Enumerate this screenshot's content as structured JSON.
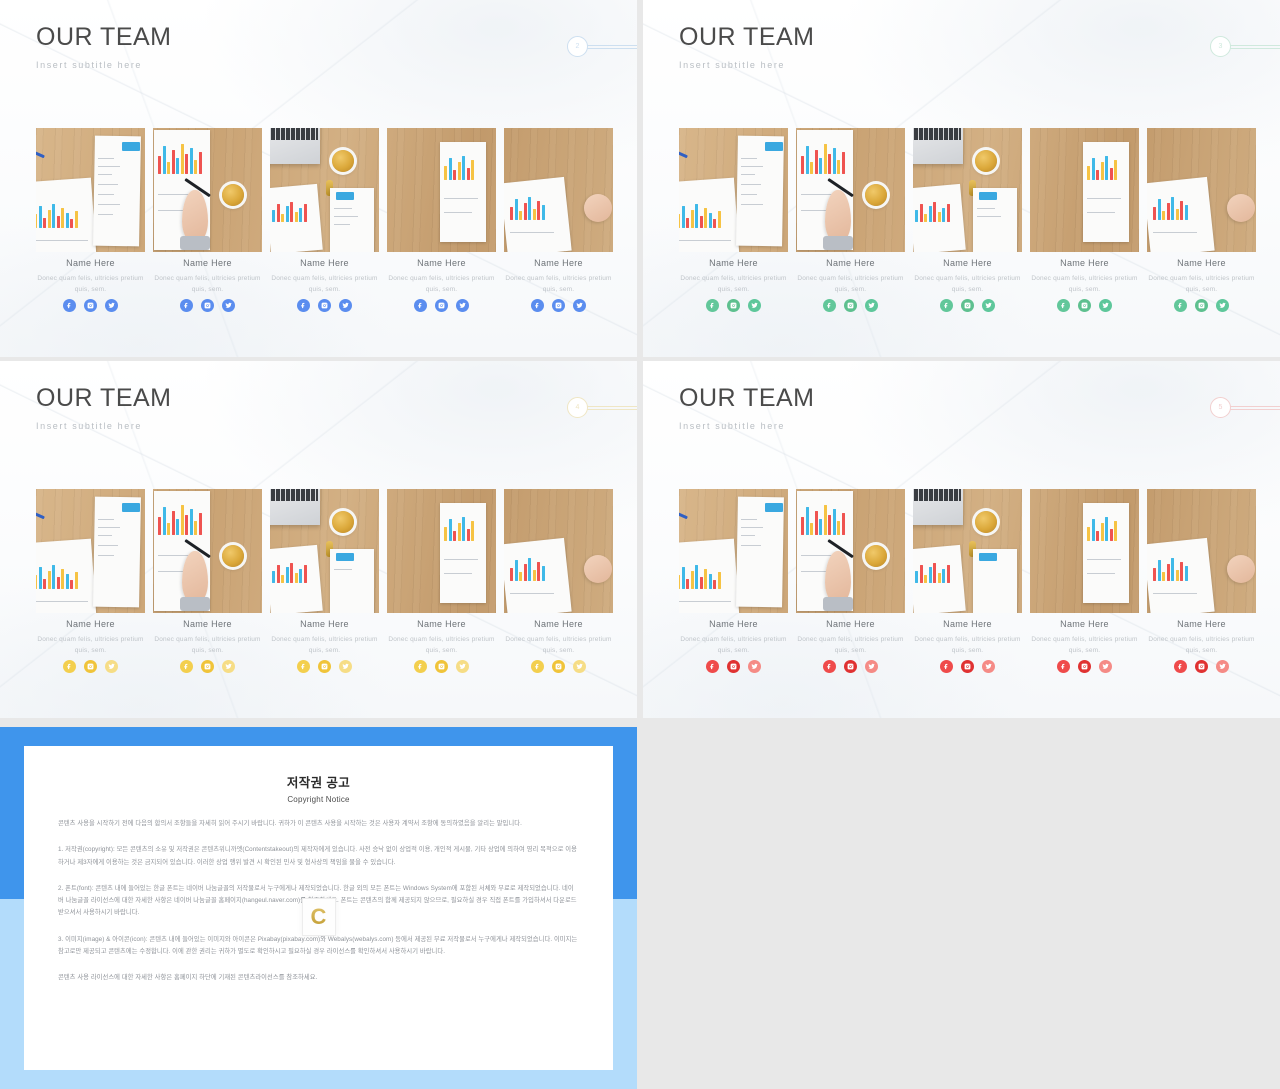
{
  "slides": [
    {
      "id": "slide-2",
      "theme": "blue",
      "title": "OUR TEAM",
      "subtitle": "Insert  subtitle  here",
      "badge": "2",
      "members": [
        {
          "name": "Name Here",
          "desc": "Donec  quam  felis,  ultricies  pretium  quis,  sem."
        },
        {
          "name": "Name Here",
          "desc": "Donec  quam  felis,  ultricies  pretium  quis,  sem."
        },
        {
          "name": "Name Here",
          "desc": "Donec  quam  felis,  ultricies  pretium  quis,  sem."
        },
        {
          "name": "Name Here",
          "desc": "Donec  quam  felis,  ultricies  pretium  quis,  sem."
        },
        {
          "name": "Name Here",
          "desc": "Donec  quam  felis,  ultricies  pretium  quis,  sem."
        }
      ]
    },
    {
      "id": "slide-3",
      "theme": "green",
      "title": "OUR TEAM",
      "subtitle": "Insert  subtitle  here",
      "badge": "3",
      "members": [
        {
          "name": "Name Here",
          "desc": "Donec  quam  felis,  ultricies  pretium  quis,  sem."
        },
        {
          "name": "Name Here",
          "desc": "Donec  quam  felis,  ultricies  pretium  quis,  sem."
        },
        {
          "name": "Name Here",
          "desc": "Donec  quam  felis,  ultricies  pretium  quis,  sem."
        },
        {
          "name": "Name Here",
          "desc": "Donec  quam  felis,  ultricies  pretium  quis,  sem."
        },
        {
          "name": "Name Here",
          "desc": "Donec  quam  felis,  ultricies  pretium  quis,  sem."
        }
      ]
    },
    {
      "id": "slide-4",
      "theme": "yellow",
      "title": "OUR TEAM",
      "subtitle": "Insert  subtitle  here",
      "badge": "4",
      "members": [
        {
          "name": "Name Here",
          "desc": "Donec  quam  felis,  ultricies  pretium  quis,  sem."
        },
        {
          "name": "Name Here",
          "desc": "Donec  quam  felis,  ultricies  pretium  quis,  sem."
        },
        {
          "name": "Name Here",
          "desc": "Donec  quam  felis,  ultricies  pretium  quis,  sem."
        },
        {
          "name": "Name Here",
          "desc": "Donec  quam  felis,  ultricies  pretium  quis,  sem."
        },
        {
          "name": "Name Here",
          "desc": "Donec  quam  felis,  ultricies  pretium  quis,  sem."
        }
      ]
    },
    {
      "id": "slide-5",
      "theme": "red",
      "title": "OUR TEAM",
      "subtitle": "Insert  subtitle  here",
      "badge": "5",
      "members": [
        {
          "name": "Name Here",
          "desc": "Donec  quam  felis,  ultricies  pretium  quis,  sem."
        },
        {
          "name": "Name Here",
          "desc": "Donec  quam  felis,  ultricies  pretium  quis,  sem."
        },
        {
          "name": "Name Here",
          "desc": "Donec  quam  felis,  ultricies  pretium  quis,  sem."
        },
        {
          "name": "Name Here",
          "desc": "Donec  quam  felis,  ultricies  pretium  quis,  sem."
        },
        {
          "name": "Name Here",
          "desc": "Donec  quam  felis,  ultricies  pretium  quis,  sem."
        }
      ]
    }
  ],
  "social_icons": [
    {
      "name": "facebook-icon",
      "label": "f"
    },
    {
      "name": "instagram-icon",
      "label": "o"
    },
    {
      "name": "twitter-icon",
      "label": "t"
    }
  ],
  "copyright": {
    "title_ko": "저작권 공고",
    "title_en": "Copyright Notice",
    "watermark": "C",
    "paragraphs": [
      "콘텐츠 사용을 시작하기 전에 다음의 합의서 조항들을 자세히 읽어 주시기 바랍니다. 귀하가 이 콘텐츠 사용을 시작하는 것은 사용자 계약서 조항에 동의하였음을 알리는 말입니다.",
      "1. 저작권(copyright): 모든 콘텐츠의 소유 및 저작권은 콘텐츠위니까엣(Contentstakeout)의 제작자에게 있습니다. 사전 승낙 없이 상업적 이용, 개인적 게시물, 기타 상업에 의하여 영리 목적으로 이용하거나 제3자에게 이용하는 것은 금지되어 있습니다. 이러한 상업 행위 발견 시 확인된 민사 및 형사상의 책임을 물을 수 있습니다.",
      "2. 폰트(font): 콘텐츠 내에 들어있는 한글 폰트는 네이버 나눔글꼴의 저작물로서 누구에게나 제작되었습니다. 한글 외의 모든 폰트는 Windows System에 포함된 서체와 무료로 제작되었습니다. 네이버 나눔글꼴 라이선스에 대한 자세한 사항은 네이버 나눔글꼴 홈페이지(hangeul.naver.com)를 참조하세요. 폰트는 콘텐츠의 함께 제공되지 않으므로, 필요하실 경우 직접 폰트를 가입하셔서 다운로드 받으셔서 사용하시기 바랍니다.",
      "3. 이미지(image) & 아이콘(icon): 콘텐츠 내에 들어있는 이미지와 아이콘은 Pixabay(pixabay.com)와 Webalys(webalys.com) 등에서 제공된 무료 저작물로서 누구에게나 제작되었습니다. 이미지는 참고로만 제공되고 콘텐츠에는 수정합니다. 이에 관한 권리는 귀하가 별도로 확인하시고 필요하실 경우 라이선스를 확인하셔서 사용하시기 바랍니다.",
      "콘텐츠 사용 라이선스에 대한 자세한 사항은 홈페이지 하단에 기재된 콘텐츠라이선스를 참조하세요."
    ]
  }
}
